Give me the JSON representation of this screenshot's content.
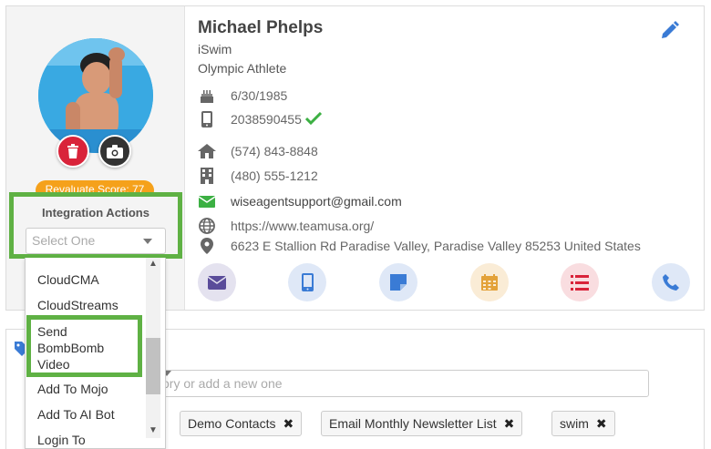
{
  "contact": {
    "name": "Michael Phelps",
    "company": "iSwim",
    "job_title": "Olympic Athlete",
    "birthday": "6/30/1985",
    "mobile": "2038590455",
    "home_phone": "(574) 843-8848",
    "work_phone": "(480) 555-1212",
    "email": "wiseagentsupport@gmail.com",
    "website": "https://www.teamusa.org/",
    "address": "6623 E Stallion Rd Paradise Valley, Paradise Valley 85253 United States"
  },
  "profile": {
    "score_label": "Revaluate Score: 77"
  },
  "integration": {
    "title": "Integration Actions",
    "placeholder": "Select One",
    "options_visible": [
      "CloudCMA",
      "CloudStreams",
      "Send BombBomb Video",
      "Add To Mojo",
      "Add To AI Bot",
      "Login To"
    ],
    "highlighted": "Send BombBomb Video"
  },
  "categories": {
    "placeholder": "ory or add a new one",
    "tags": [
      "Demo Contacts",
      "Email Monthly Newsletter List",
      "swim"
    ],
    "tag_remove_symbol": "✖"
  },
  "icons": {
    "edit": "pencil-icon",
    "birthday": "cake-icon",
    "mobile": "mobile-icon",
    "home": "home-icon",
    "work": "building-icon",
    "email": "envelope-icon",
    "website": "globe-icon",
    "address": "map-pin-icon",
    "verified": "check-icon"
  },
  "colors": {
    "accent_blue": "#3a7bd5",
    "highlight_green": "#5fb144",
    "delete_red": "#d9233a",
    "score_orange": "#f5a11b",
    "verified_green": "#3cb043"
  }
}
